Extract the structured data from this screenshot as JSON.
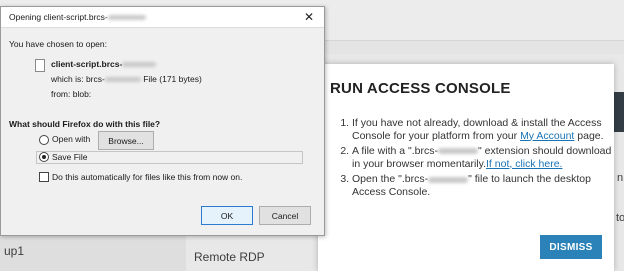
{
  "background": {
    "left_rows": [
      "",
      "",
      "",
      "up1"
    ],
    "right_label": "Remote RDP",
    "edge_texts": [
      "n",
      "to",
      "p"
    ]
  },
  "modal": {
    "title": "RUN ACCESS CONSOLE",
    "step1_text": "If you have not already, download & install the Access Console for your platform from your ",
    "step1_link": "My Account",
    "step1_tail": " page.",
    "step2_pre": "A file with a \".brcs-",
    "step2_post": "\" extension should download in your browser momentarily.",
    "step2_link": "If not, click here.",
    "step3_pre": "Open the \".brcs-",
    "step3_post": "\" file to launch the desktop Access Console.",
    "dismiss_label": "DISMISS"
  },
  "firefox_dialog": {
    "title": "Opening client-script.brcs-",
    "close_glyph": "✕",
    "chosen_label": "You have chosen to open:",
    "file_name": "client-script.brcs-",
    "which_is_pre": "which is: brcs-",
    "which_is_post": " File (171 bytes)",
    "from": "from: blob:",
    "question": "What should Firefox do with this file?",
    "open_with_label": "Open with",
    "browse_label": "Browse...",
    "save_file_label": "Save File",
    "auto_label": "Do this automatically for files like this from now on.",
    "ok_label": "OK",
    "cancel_label": "Cancel",
    "selected_option": "Save File"
  }
}
